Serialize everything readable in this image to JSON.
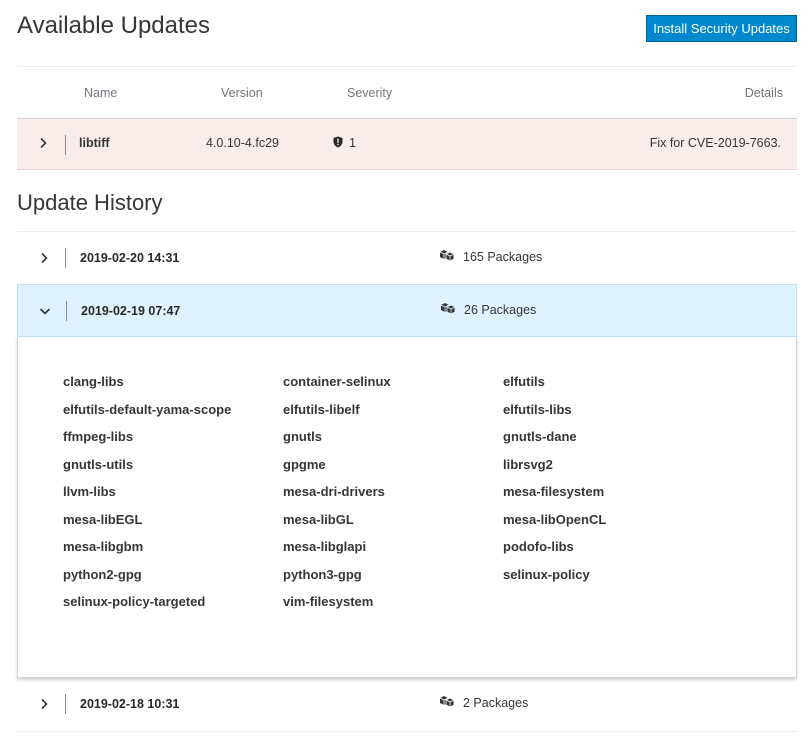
{
  "page": {
    "title": "Available Updates",
    "install_button": "Install Security Updates"
  },
  "updates_table": {
    "columns": [
      "Name",
      "Version",
      "Severity",
      "Details"
    ],
    "rows": [
      {
        "name": "libtiff",
        "version": "4.0.10-4.fc29",
        "severity_icon": "security-shield-icon",
        "severity": "1",
        "details": "Fix for CVE-2019-7663."
      }
    ]
  },
  "history": {
    "title": "Update History",
    "entries": [
      {
        "date": "2019-02-20 14:31",
        "count": "165 Packages",
        "expanded": false
      },
      {
        "date": "2019-02-19 07:47",
        "count": "26 Packages",
        "expanded": true
      },
      {
        "date": "2019-02-18 10:31",
        "count": "2 Packages",
        "expanded": false
      }
    ],
    "expanded_packages": [
      "clang-libs",
      "container-selinux",
      "elfutils",
      "elfutils-default-yama-scope",
      "elfutils-libelf",
      "elfutils-libs",
      "ffmpeg-libs",
      "gnutls",
      "gnutls-dane",
      "gnutls-utils",
      "gpgme",
      "librsvg2",
      "llvm-libs",
      "mesa-dri-drivers",
      "mesa-filesystem",
      "mesa-libEGL",
      "mesa-libGL",
      "mesa-libOpenCL",
      "mesa-libgbm",
      "mesa-libglapi",
      "podofo-libs",
      "python2-gpg",
      "python3-gpg",
      "selinux-policy",
      "selinux-policy-targeted",
      "vim-filesystem"
    ]
  },
  "colors": {
    "primary_button": "#0088ce",
    "security_row_bg": "#f9ecea",
    "expanded_row_bg": "#def3ff"
  }
}
